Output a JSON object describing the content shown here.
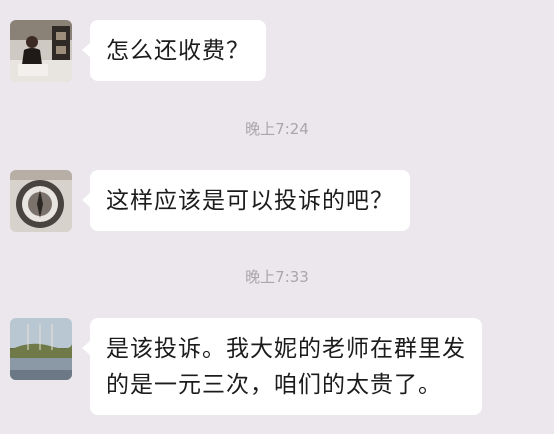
{
  "messages": [
    {
      "text": "怎么还收费？",
      "avatar": "person-photo-avatar"
    },
    {
      "text": "这样应该是可以投诉的吧？",
      "avatar": "compass-avatar"
    },
    {
      "text_line1": "是该投诉。我大妮的老师在群里发",
      "text_line2": "的是一元三次，咱们的太贵了。",
      "avatar": "landscape-avatar"
    }
  ],
  "timestamps": [
    "晚上7:24",
    "晚上7:33"
  ]
}
